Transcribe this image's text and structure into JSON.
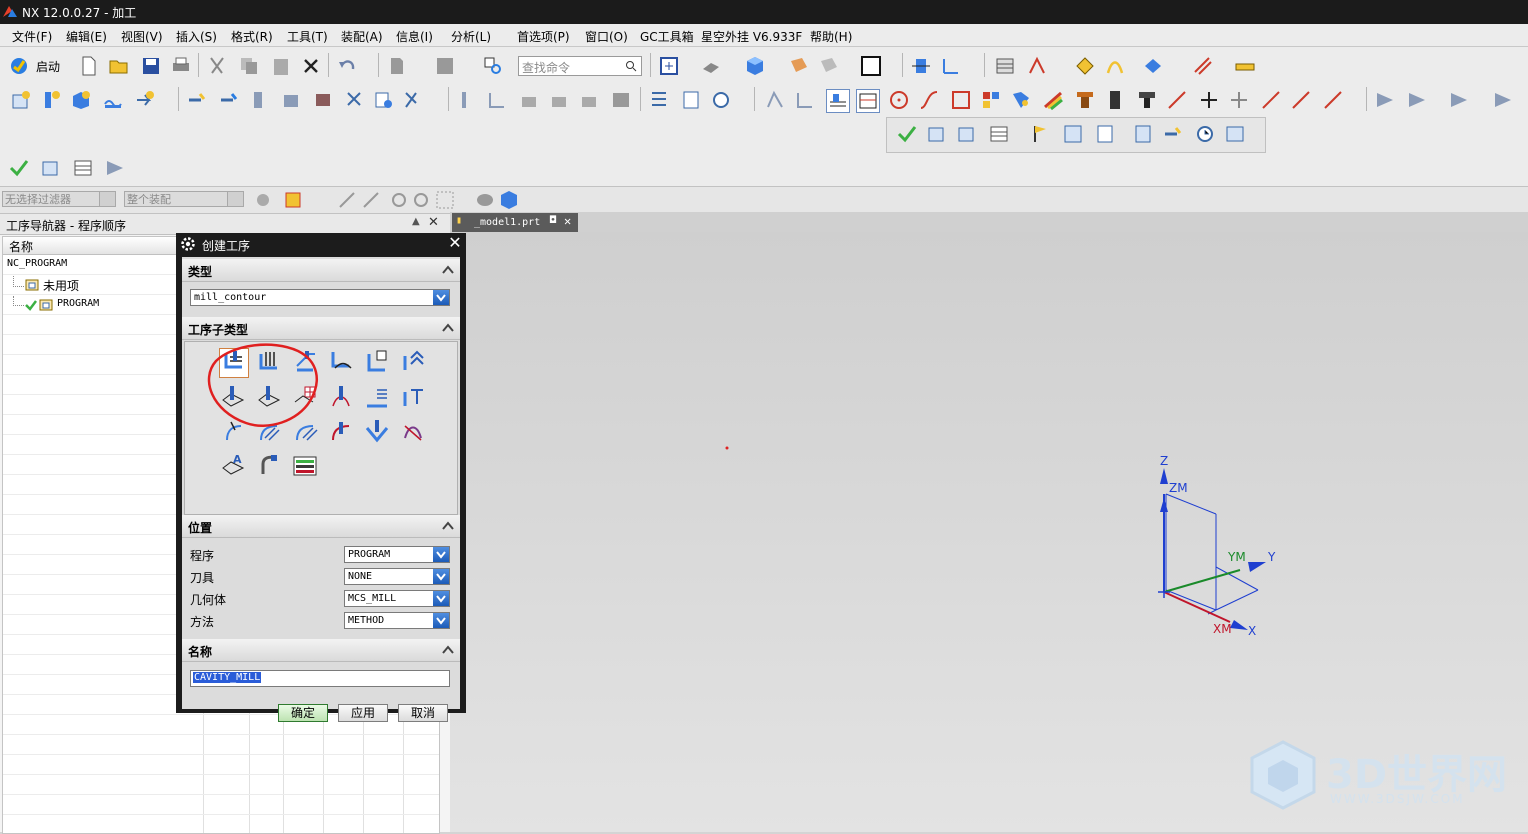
{
  "window": {
    "title": "NX 12.0.0.27 - 加工"
  },
  "menu": [
    "文件(F)",
    "编辑(E)",
    "视图(V)",
    "插入(S)",
    "格式(R)",
    "工具(T)",
    "装配(A)",
    "信息(I)",
    "分析(L)",
    "首选项(P)",
    "窗口(O)",
    "GC工具箱",
    "星空外挂 V6.933F",
    "帮助(H)"
  ],
  "toolbar": {
    "start_label": "启动",
    "search_placeholder": "查找命令"
  },
  "selection_bar": {
    "filter": "无选择过滤器",
    "scope": "整个装配"
  },
  "navigator": {
    "title": "工序导航器 - 程序顺序",
    "column_name": "名称",
    "tree": [
      {
        "label": "NC_PROGRAM"
      },
      {
        "label": "未用项"
      },
      {
        "label": "PROGRAM"
      }
    ]
  },
  "file_tab": {
    "label": "_model1.prt"
  },
  "dialog": {
    "title": "创建工序",
    "type_section": "类型",
    "type_value": "mill_contour",
    "subtype_section": "工序子类型",
    "location_section": "位置",
    "fields": [
      {
        "label": "程序",
        "value": "PROGRAM"
      },
      {
        "label": "刀具",
        "value": "NONE"
      },
      {
        "label": "几何体",
        "value": "MCS_MILL"
      },
      {
        "label": "方法",
        "value": "METHOD"
      }
    ],
    "name_section": "名称",
    "name_value": "CAVITY_MILL",
    "ok": "确定",
    "apply": "应用",
    "cancel": "取消"
  },
  "triad": {
    "z": "Z",
    "zm": "ZM",
    "y": "Y",
    "ym": "YM",
    "x": "X",
    "xm": "XM"
  },
  "watermark": {
    "brand": "3D世界网",
    "url": "WWW.3DSJW.COM"
  }
}
